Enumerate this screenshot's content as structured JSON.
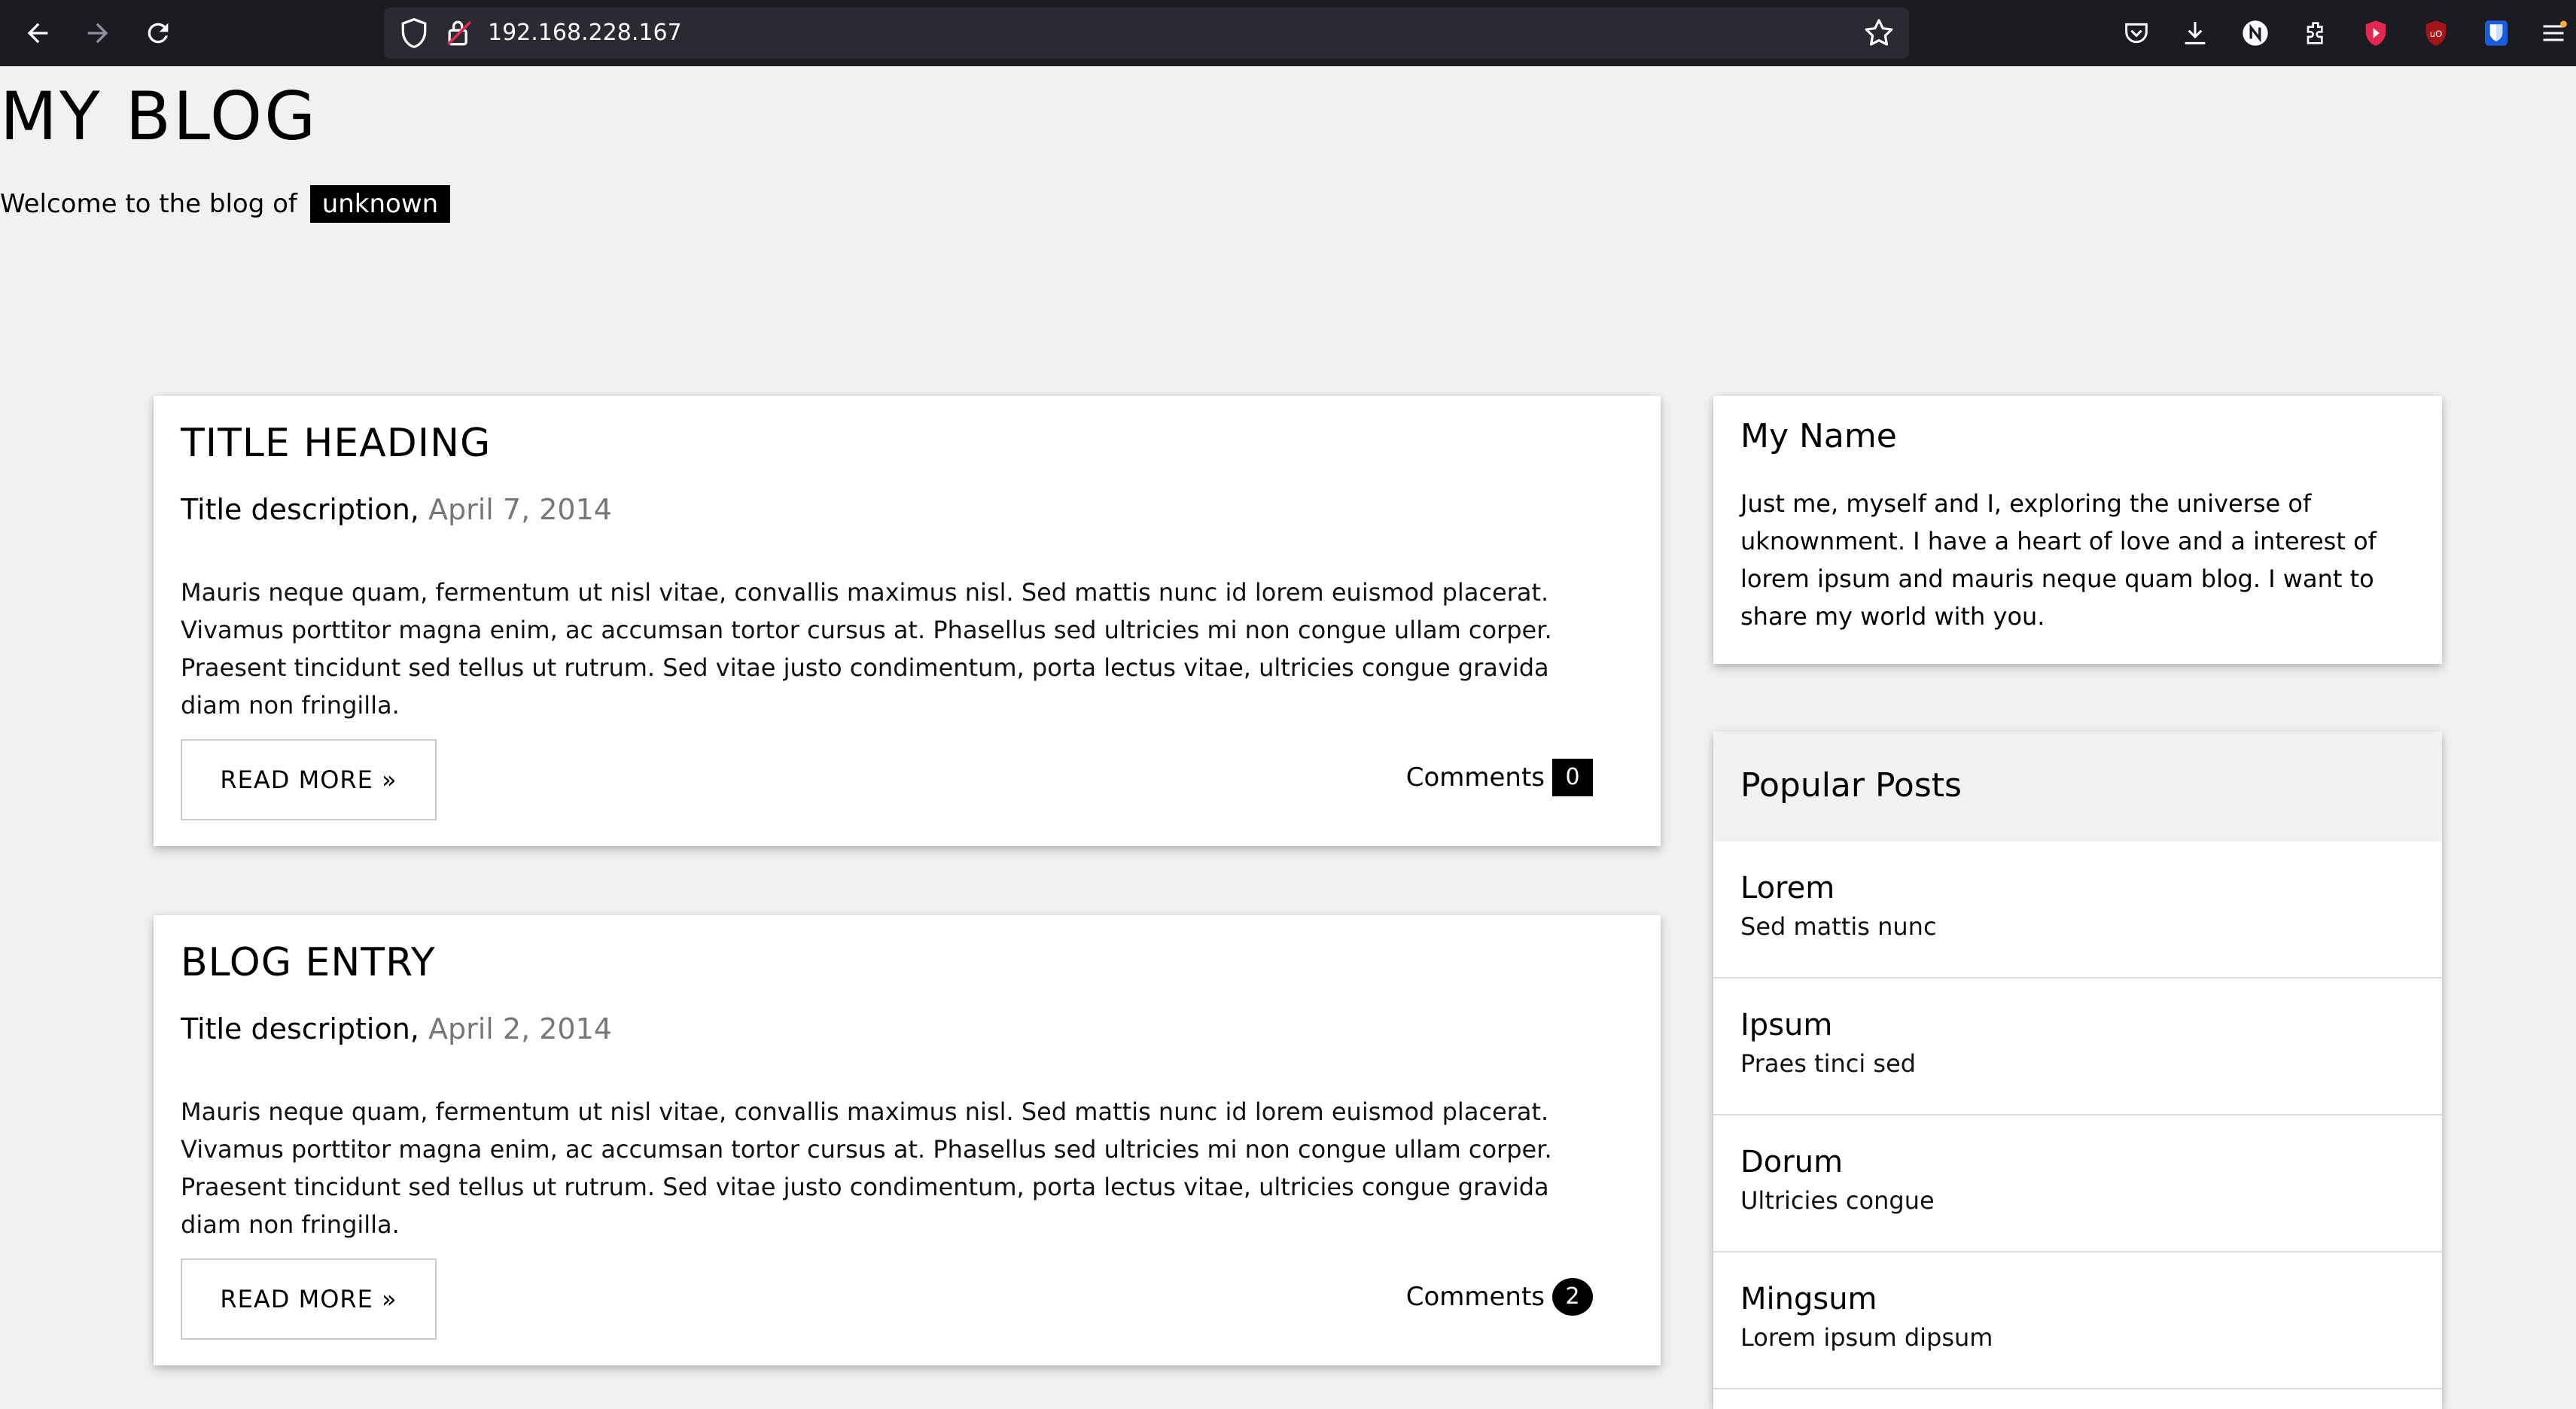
{
  "browser": {
    "url": "192.168.228.167"
  },
  "header": {
    "title": "MY BLOG",
    "welcome_prefix": "Welcome to the blog of",
    "welcome_name": "unknown"
  },
  "posts": [
    {
      "title": "TITLE HEADING",
      "description": "Title description,",
      "date": "April 7, 2014",
      "body": "Mauris neque quam, fermentum ut nisl vitae, convallis maximus nisl. Sed mattis nunc id lorem euismod placerat. Vivamus porttitor magna enim, ac accumsan tortor cursus at. Phasellus sed ultricies mi non congue ullam corper. Praesent tincidunt sed tellus ut rutrum. Sed vitae justo condimentum, porta lectus vitae, ultricies congue gravida diam non fringilla.",
      "read_more_label": "READ MORE »",
      "comments_label": "Comments",
      "comments_count": "0"
    },
    {
      "title": "BLOG ENTRY",
      "description": "Title description,",
      "date": "April 2, 2014",
      "body": "Mauris neque quam, fermentum ut nisl vitae, convallis maximus nisl. Sed mattis nunc id lorem euismod placerat. Vivamus porttitor magna enim, ac accumsan tortor cursus at. Phasellus sed ultricies mi non congue ullam corper. Praesent tincidunt sed tellus ut rutrum. Sed vitae justo condimentum, porta lectus vitae, ultricies congue gravida diam non fringilla.",
      "read_more_label": "READ MORE »",
      "comments_label": "Comments",
      "comments_count": "2"
    }
  ],
  "sidebar": {
    "about": {
      "title": "My Name",
      "text": "Just me, myself and I, exploring the universe of uknownment. I have a heart of love and a interest of lorem ipsum and mauris neque quam blog. I want to share my world with you."
    },
    "popular": {
      "title": "Popular Posts",
      "items": [
        {
          "title": "Lorem",
          "subtitle": "Sed mattis nunc"
        },
        {
          "title": "Ipsum",
          "subtitle": "Praes tinci sed"
        },
        {
          "title": "Dorum",
          "subtitle": "Ultricies congue"
        },
        {
          "title": "Mingsum",
          "subtitle": "Lorem ipsum dipsum"
        }
      ]
    }
  },
  "colors": {
    "page_bg": "#f1f1f1",
    "card_bg": "#ffffff",
    "browser_bg": "#1c1b22",
    "urlbar_bg": "#2b2a33",
    "badge_bg": "#000000",
    "date_text": "#777777"
  },
  "icons": {
    "nav": [
      "back-arrow-icon",
      "forward-arrow-icon",
      "reload-icon"
    ],
    "url": [
      "shield-icon",
      "lock-warning-icon",
      "star-icon"
    ],
    "toolbar": [
      "pocket-icon",
      "download-icon",
      "notion-icon",
      "extensions-icon",
      "youtube-icon",
      "ublock-icon",
      "bitwarden-icon",
      "menu-icon"
    ]
  }
}
